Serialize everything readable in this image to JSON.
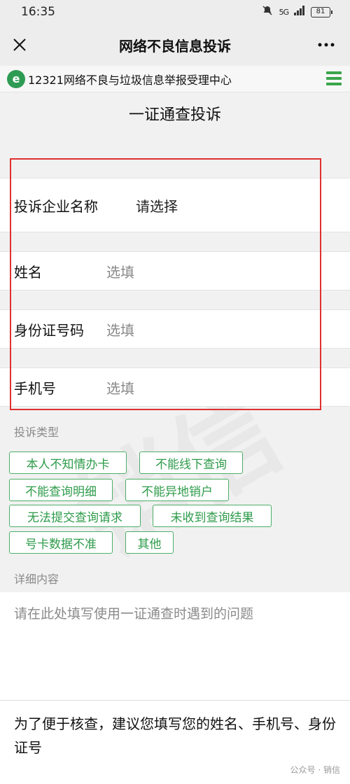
{
  "status_bar": {
    "time": "16:35",
    "battery": "81",
    "network": "5G"
  },
  "title_bar": {
    "title": "网络不良信息投诉",
    "close_icon": "close-icon",
    "more_icon": "more-icon"
  },
  "site": {
    "logo_text": "e",
    "name": "12321网络不良与垃圾信息举报受理中心",
    "menu_icon": "hamburger-menu-icon"
  },
  "page_title": "一证通查投诉",
  "form": {
    "company": {
      "label": "投诉企业名称",
      "value": "请选择"
    },
    "name": {
      "label": "姓名",
      "placeholder": "选填"
    },
    "id_number": {
      "label": "身份证号码",
      "placeholder": "选填"
    },
    "phone": {
      "label": "手机号",
      "placeholder": "选填"
    }
  },
  "complaint_types": {
    "label": "投诉类型",
    "options": [
      "本人不知情办卡",
      "不能线下查询",
      "不能查询明细",
      "不能异地销户",
      "无法提交查询请求",
      "未收到查询结果",
      "号卡数据不准",
      "其他"
    ]
  },
  "detail": {
    "label": "详细内容",
    "placeholder": "请在此处填写使用一证通查时遇到的问题"
  },
  "notice": {
    "text": "为了便于核查，建议您填写您的姓名、手机号、身份证号"
  },
  "watermark": {
    "footer": "公众号 · 销信",
    "background": "销信"
  },
  "colors": {
    "accent_green": "#2e9b4a",
    "highlight_red": "#e03030"
  }
}
